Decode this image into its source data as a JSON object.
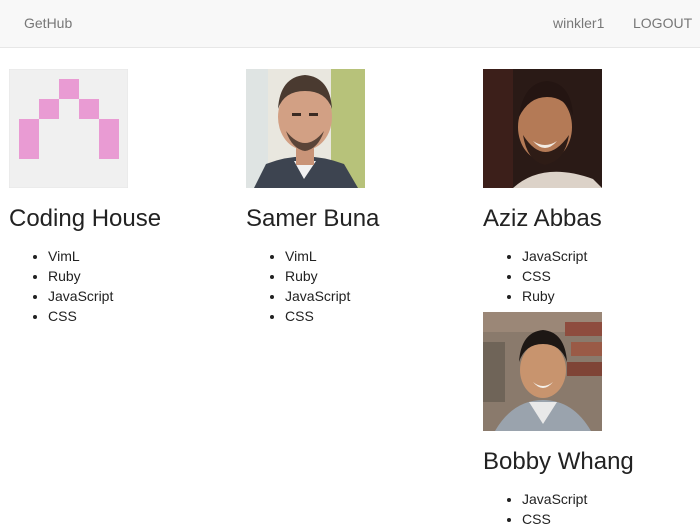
{
  "navbar": {
    "brand": "GetHub",
    "username": "winkler1",
    "logout_label": "LOGOUT"
  },
  "users": [
    {
      "name": "Coding House",
      "avatar": "identicon-avatar",
      "languages": [
        "VimL",
        "Ruby",
        "JavaScript",
        "CSS"
      ]
    },
    {
      "name": "Samer Buna",
      "avatar": "photo-avatar",
      "languages": [
        "VimL",
        "Ruby",
        "JavaScript",
        "CSS"
      ]
    },
    {
      "name": "Aziz Abbas",
      "avatar": "photo-avatar",
      "languages": [
        "JavaScript",
        "CSS",
        "Ruby"
      ]
    },
    {
      "name": "Bobby Whang",
      "avatar": "photo-avatar",
      "languages": [
        "JavaScript",
        "CSS"
      ]
    }
  ],
  "colors": {
    "navbar_bg": "#f8f8f8",
    "nav_text": "#777777",
    "identicon": "#e99bd3"
  }
}
